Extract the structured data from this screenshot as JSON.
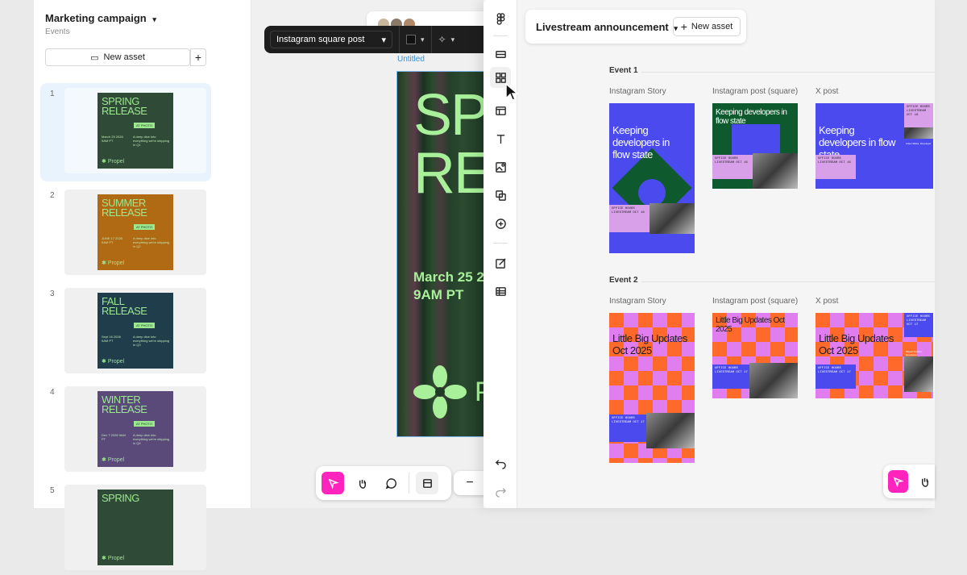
{
  "left_window": {
    "project_title": "Marketing campaign",
    "project_subtitle": "Events",
    "new_asset_label": "New asset",
    "frames": [
      {
        "num": "1",
        "title": "SPRING RELEASE",
        "badge": "AT PHOTO",
        "date": "March 25 2026 9AM PT",
        "text": "A deep dive into everything we're shipping in Q1",
        "brand": "Propel",
        "bg": "#2f4a36"
      },
      {
        "num": "2",
        "title": "SUMMER RELEASE",
        "badge": "AT PHOTO",
        "date": "JUNE 17 2026 9AM PT",
        "text": "A deep dive into everything we're shipping in Q2",
        "brand": "Propel",
        "bg": "#b06a14"
      },
      {
        "num": "3",
        "title": "FALL RELEASE",
        "badge": "AT PHOTO",
        "date": "Sept 16 2026 9AM PT",
        "text": "A deep dive into everything we're shipping in Q3",
        "brand": "Propel",
        "bg": "#1f3d4a"
      },
      {
        "num": "4",
        "title": "WINTER RELEASE",
        "badge": "AT PHOTO",
        "date": "Dec 7 2026 9AM PT",
        "text": "A deep dive into everything we're shipping in Q4",
        "brand": "Propel",
        "bg": "#5a4a7a"
      },
      {
        "num": "5",
        "title": "SPRING",
        "badge": "",
        "date": "",
        "text": "",
        "brand": "Propel",
        "bg": "#2f4a36"
      }
    ],
    "toolbar": {
      "format_select": "Instagram square post"
    },
    "canvas_frame_label": "Untitled",
    "big_poster": {
      "title": "SPR RE",
      "date": "March 25 2 9AM PT",
      "brand": "P"
    }
  },
  "right_window": {
    "project_title": "Livestream announcement",
    "new_asset_label": "New asset",
    "events": [
      {
        "label": "Event 1",
        "columns": [
          "Instagram Story",
          "Instagram post (square)",
          "X post"
        ],
        "headline": "Keeping developers in flow state",
        "badge_text": "OFFICE HOURS LIVESTREAM OCT 16",
        "x_caption": "Ankur Mittra, Developer"
      },
      {
        "label": "Event 2",
        "columns": [
          "Instagram Story",
          "Instagram post (square)",
          "X post"
        ],
        "headline": "Little Big Updates Oct 2025",
        "badge_text": "OFFICE HOURS LIVESTREAM OCT 17",
        "x_caption": "Miguel Gordon, Developer"
      }
    ]
  },
  "colors": {
    "accent_pink": "#ff24bd",
    "event1_blue": "#4a4aee",
    "event1_green": "#0e5a2e",
    "event1_lilac": "#d8a0e8",
    "event2_orange": "#ff6a2a",
    "event2_pink": "#e07ef0",
    "selection_blue": "#3a8fd8"
  }
}
